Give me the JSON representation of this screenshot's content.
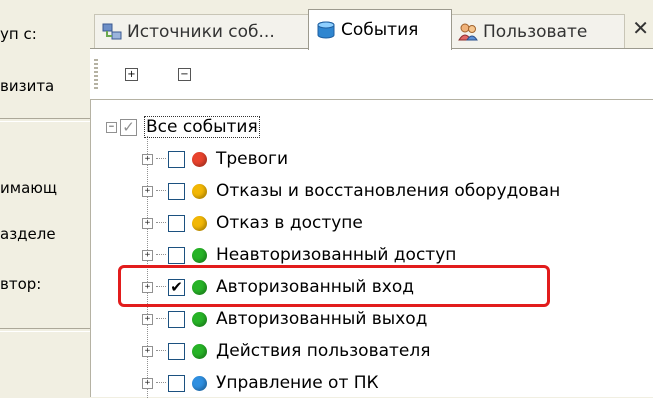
{
  "left": {
    "labels": [
      "уп с:",
      "визита",
      "имающ",
      "азделе",
      "втор:"
    ]
  },
  "tabs": [
    {
      "label": "Источники соб...",
      "icon": "event-sources-icon"
    },
    {
      "label": "События",
      "icon": "database-icon"
    },
    {
      "label": "Пользовате",
      "icon": "users-icon"
    }
  ],
  "close_glyph": "✕",
  "toolbar": {
    "expand_glyph": "+",
    "collapse_glyph": "−"
  },
  "tree": {
    "root": {
      "label": "Все события",
      "checked": "partial",
      "expander": "−"
    },
    "items": [
      {
        "label": "Тревоги",
        "color": "#e8432d",
        "checked": false,
        "expander": "+"
      },
      {
        "label": "Отказы и восстановления оборудован",
        "color": "#f2b705",
        "checked": false,
        "expander": "+"
      },
      {
        "label": "Отказ в доступе",
        "color": "#f2b705",
        "checked": false,
        "expander": "+"
      },
      {
        "label": "Неавторизованный доступ",
        "color": "#27b327",
        "checked": false,
        "expander": "+"
      },
      {
        "label": "Авторизованный вход",
        "color": "#27b327",
        "checked": true,
        "expander": "+"
      },
      {
        "label": "Авторизованный выход",
        "color": "#27b327",
        "checked": false,
        "expander": "+"
      },
      {
        "label": "Действия пользователя",
        "color": "#27b327",
        "checked": false,
        "expander": "+"
      },
      {
        "label": "Управление от ПК",
        "color": "#2f8fe0",
        "checked": false,
        "expander": "+"
      }
    ]
  },
  "colors": {
    "highlight": "#e21c1c",
    "panel_bg": "#f1efe2"
  }
}
